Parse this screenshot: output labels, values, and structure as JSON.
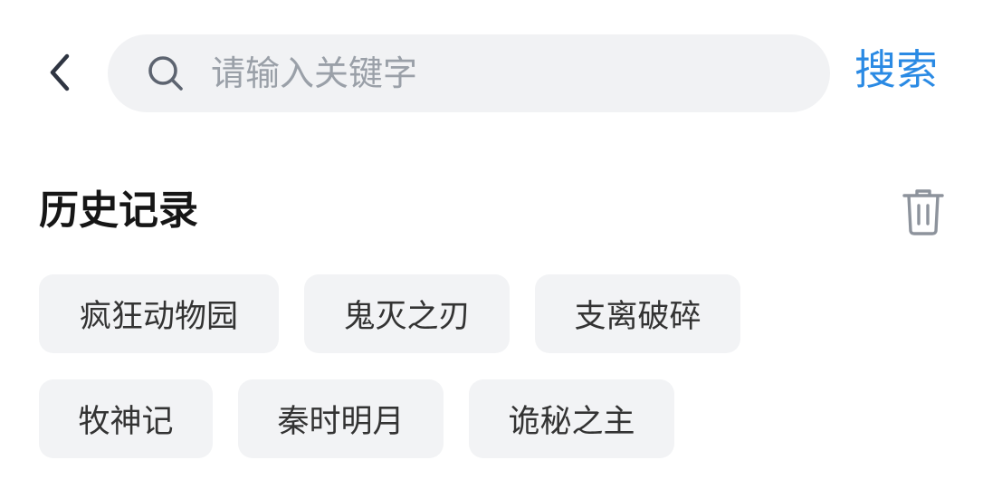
{
  "header": {
    "back_icon": "chevron-left-icon",
    "search_icon": "search-icon",
    "search_placeholder": "请输入关键字",
    "search_value": "",
    "search_action_label": "搜索",
    "accent_color": "#2a8ae4"
  },
  "history": {
    "title": "历史记录",
    "clear_icon": "trash-icon",
    "items": [
      {
        "label": "疯狂动物园"
      },
      {
        "label": "鬼灭之刃"
      },
      {
        "label": "支离破碎"
      },
      {
        "label": "牧神记"
      },
      {
        "label": "秦时明月"
      },
      {
        "label": "诡秘之主"
      }
    ]
  }
}
